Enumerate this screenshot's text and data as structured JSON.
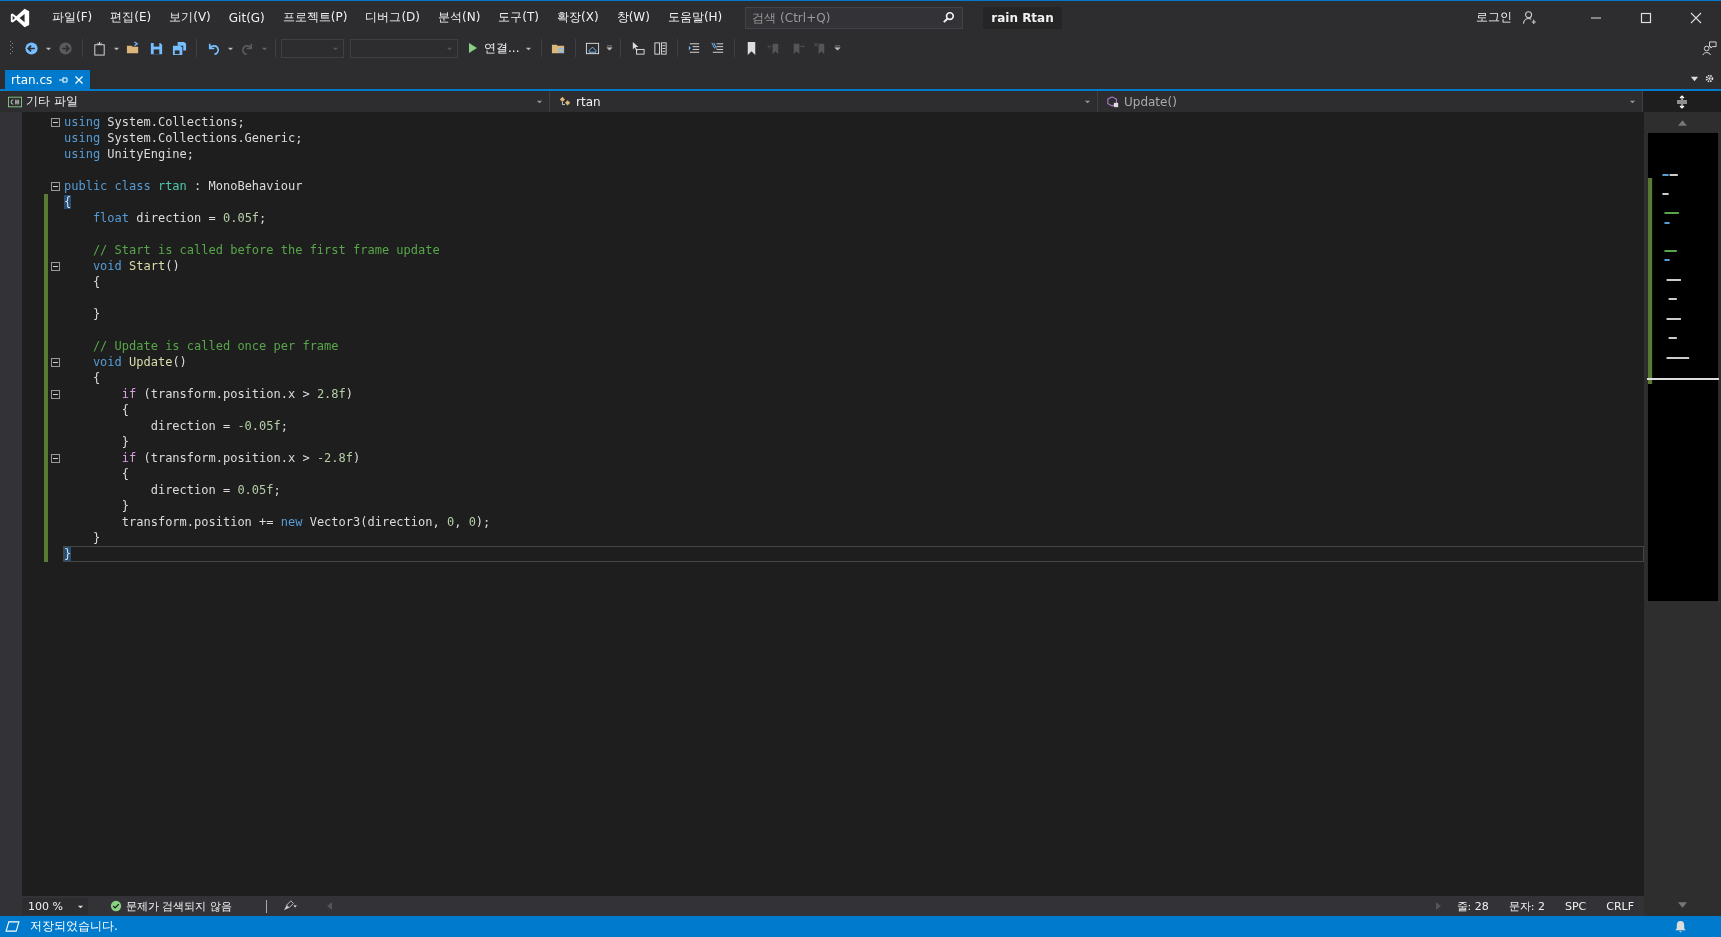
{
  "window": {
    "title": "rain Rtan",
    "login": "로그인"
  },
  "menu": [
    {
      "label": "파일(F)"
    },
    {
      "label": "편집(E)"
    },
    {
      "label": "보기(V)"
    },
    {
      "label": "Git(G)"
    },
    {
      "label": "프로젝트(P)"
    },
    {
      "label": "디버그(D)"
    },
    {
      "label": "분석(N)"
    },
    {
      "label": "도구(T)"
    },
    {
      "label": "확장(X)"
    },
    {
      "label": "창(W)"
    },
    {
      "label": "도움말(H)"
    }
  ],
  "search": {
    "placeholder": "검색 (Ctrl+Q)"
  },
  "toolbar": {
    "run_label": "연결..."
  },
  "tabs": [
    {
      "label": "rtan.cs",
      "selected": true
    }
  ],
  "nav": {
    "project": "기타 파일",
    "class": "rtan",
    "member": "Update()"
  },
  "code": {
    "lines": [
      {
        "fold": true,
        "changed": false,
        "current": false,
        "tokens": [
          {
            "kind": "keyword",
            "text": "using"
          },
          {
            "kind": "plain",
            "text": " System.Collections;"
          }
        ]
      },
      {
        "fold": false,
        "changed": false,
        "current": false,
        "tokens": [
          {
            "kind": "keyword",
            "text": "using"
          },
          {
            "kind": "plain",
            "text": " System.Collections.Generic;"
          }
        ]
      },
      {
        "fold": false,
        "changed": false,
        "current": false,
        "tokens": [
          {
            "kind": "keyword",
            "text": "using"
          },
          {
            "kind": "plain",
            "text": " UnityEngine;"
          }
        ]
      },
      {
        "fold": false,
        "changed": false,
        "current": false
      },
      {
        "fold": true,
        "changed": false,
        "current": false,
        "tokens": [
          {
            "kind": "keyword",
            "text": "public class "
          },
          {
            "kind": "type",
            "text": "rtan"
          },
          {
            "kind": "plain",
            "text": " : MonoBehaviour"
          }
        ]
      },
      {
        "fold": false,
        "changed": true,
        "current": false,
        "tokens": [
          {
            "kind": "brace",
            "text": "{"
          }
        ]
      },
      {
        "fold": false,
        "changed": true,
        "current": false,
        "tokens": [
          {
            "kind": "keyword",
            "text": "    float"
          },
          {
            "kind": "plain",
            "text": " direction = "
          },
          {
            "kind": "number",
            "text": "0.05f"
          },
          {
            "kind": "plain",
            "text": ";"
          }
        ]
      },
      {
        "fold": false,
        "changed": true,
        "current": false
      },
      {
        "fold": false,
        "changed": true,
        "current": false,
        "tokens": [
          {
            "kind": "comment",
            "text": "    // Start is called before the first frame update"
          }
        ]
      },
      {
        "fold": true,
        "changed": true,
        "current": false,
        "tokens": [
          {
            "kind": "keyword",
            "text": "    void"
          },
          {
            "kind": "method",
            "text": " Start"
          },
          {
            "kind": "plain",
            "text": "()"
          }
        ]
      },
      {
        "fold": false,
        "changed": true,
        "current": false,
        "tokens": [
          {
            "kind": "plain",
            "text": "    {"
          }
        ]
      },
      {
        "fold": false,
        "changed": true,
        "current": false
      },
      {
        "fold": false,
        "changed": true,
        "current": false,
        "tokens": [
          {
            "kind": "plain",
            "text": "    }"
          }
        ]
      },
      {
        "fold": false,
        "changed": true,
        "current": false
      },
      {
        "fold": false,
        "changed": true,
        "current": false,
        "tokens": [
          {
            "kind": "comment",
            "text": "    // Update is called once per frame"
          }
        ]
      },
      {
        "fold": true,
        "changed": true,
        "current": false,
        "tokens": [
          {
            "kind": "keyword",
            "text": "    void"
          },
          {
            "kind": "method",
            "text": " Update"
          },
          {
            "kind": "plain",
            "text": "()"
          }
        ]
      },
      {
        "fold": false,
        "changed": true,
        "current": false,
        "tokens": [
          {
            "kind": "plain",
            "text": "    {"
          }
        ]
      },
      {
        "fold": true,
        "changed": true,
        "current": false,
        "tokens": [
          {
            "kind": "control",
            "text": "        if"
          },
          {
            "kind": "plain",
            "text": " (transform.position.x > "
          },
          {
            "kind": "number",
            "text": "2.8f"
          },
          {
            "kind": "plain",
            "text": ")"
          }
        ]
      },
      {
        "fold": false,
        "changed": true,
        "current": false,
        "tokens": [
          {
            "kind": "plain",
            "text": "        {"
          }
        ]
      },
      {
        "fold": false,
        "changed": true,
        "current": false,
        "tokens": [
          {
            "kind": "plain",
            "text": "            direction = "
          },
          {
            "kind": "number",
            "text": "-0.05f"
          },
          {
            "kind": "plain",
            "text": ";"
          }
        ]
      },
      {
        "fold": false,
        "changed": true,
        "current": false,
        "tokens": [
          {
            "kind": "plain",
            "text": "        }"
          }
        ]
      },
      {
        "fold": true,
        "changed": true,
        "current": false,
        "tokens": [
          {
            "kind": "control",
            "text": "        if"
          },
          {
            "kind": "plain",
            "text": " (transform.position.x > "
          },
          {
            "kind": "number",
            "text": "-2.8f"
          },
          {
            "kind": "plain",
            "text": ")"
          }
        ]
      },
      {
        "fold": false,
        "changed": true,
        "current": false,
        "tokens": [
          {
            "kind": "plain",
            "text": "        {"
          }
        ]
      },
      {
        "fold": false,
        "changed": true,
        "current": false,
        "tokens": [
          {
            "kind": "plain",
            "text": "            direction = "
          },
          {
            "kind": "number",
            "text": "0.05f"
          },
          {
            "kind": "plain",
            "text": ";"
          }
        ]
      },
      {
        "fold": false,
        "changed": true,
        "current": false,
        "tokens": [
          {
            "kind": "plain",
            "text": "        }"
          }
        ]
      },
      {
        "fold": false,
        "changed": true,
        "current": false,
        "tokens": [
          {
            "kind": "plain",
            "text": "        transform.position += "
          },
          {
            "kind": "keyword",
            "text": "new"
          },
          {
            "kind": "plain",
            "text": " Vector3(direction, "
          },
          {
            "kind": "number",
            "text": "0"
          },
          {
            "kind": "plain",
            "text": ", "
          },
          {
            "kind": "number",
            "text": "0"
          },
          {
            "kind": "plain",
            "text": ");"
          }
        ]
      },
      {
        "fold": false,
        "changed": true,
        "current": false,
        "tokens": [
          {
            "kind": "plain",
            "text": "    }"
          }
        ]
      },
      {
        "fold": false,
        "changed": true,
        "current": true,
        "tokens": [
          {
            "kind": "brace",
            "text": "}"
          }
        ]
      }
    ]
  },
  "editor_status": {
    "zoom": "100 %",
    "issues": "문제가 검색되지 않음",
    "line": "줄: 28",
    "column": "문자: 2",
    "whitespace": "SPC",
    "line_ending": "CRLF"
  },
  "status_bar": {
    "message": "저장되었습니다."
  }
}
